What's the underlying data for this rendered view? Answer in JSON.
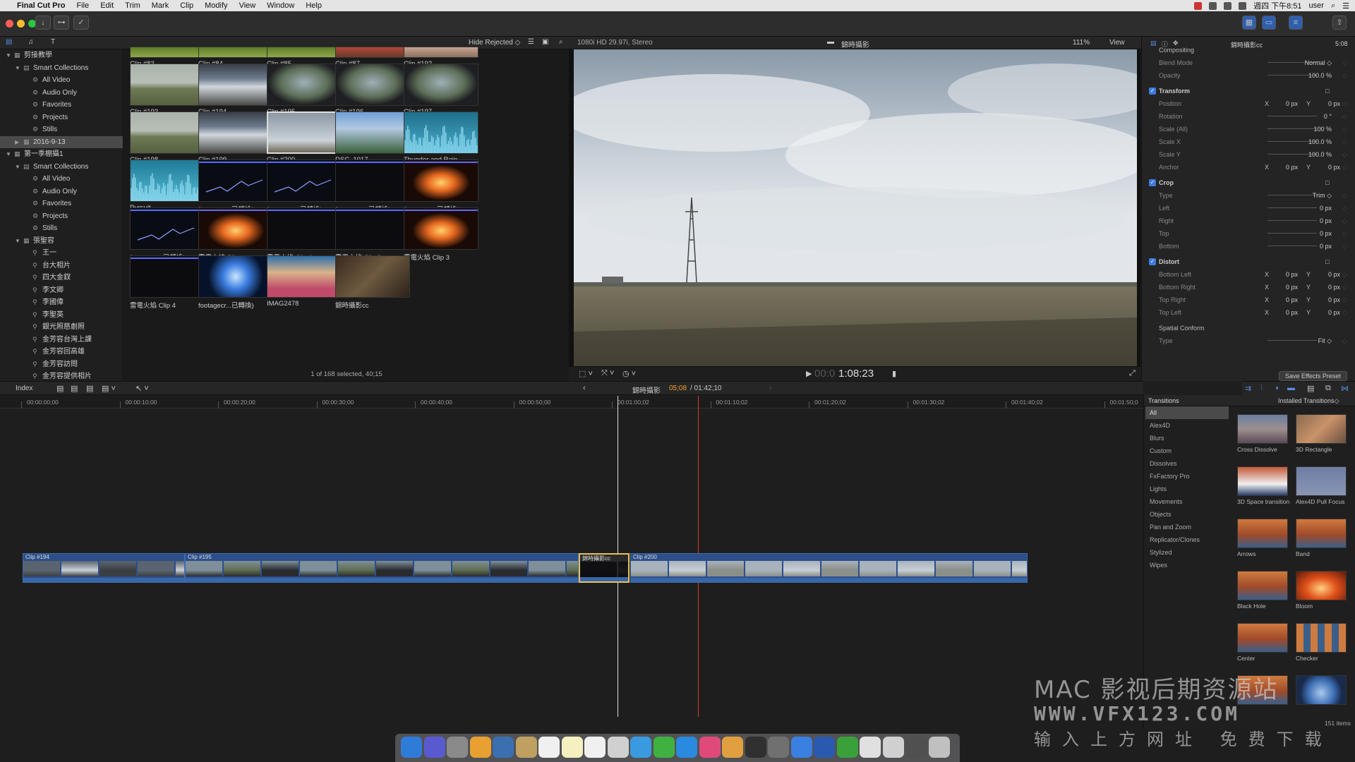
{
  "menubar": {
    "apple": "",
    "app": "Final Cut Pro",
    "items": [
      "File",
      "Edit",
      "Trim",
      "Mark",
      "Clip",
      "Modify",
      "View",
      "Window",
      "Help"
    ],
    "clock": "週四 下午8:51",
    "user": "user"
  },
  "browser_toolbar": {
    "filter": "Hide Rejected ◇",
    "format": "1080i HD 29.97i, Stereo",
    "viewer_title": "錦時攝影",
    "zoom": "111%",
    "view_menu": "View"
  },
  "library": {
    "items": [
      {
        "label": "剪接教學",
        "level": 0,
        "tri": "▼",
        "icon": "library"
      },
      {
        "label": "Smart Collections",
        "level": 1,
        "tri": "▼",
        "icon": "folder"
      },
      {
        "label": "All Video",
        "level": 2,
        "tri": "",
        "icon": "smart"
      },
      {
        "label": "Audio Only",
        "level": 2,
        "tri": "",
        "icon": "smart"
      },
      {
        "label": "Favorites",
        "level": 2,
        "tri": "",
        "icon": "smart"
      },
      {
        "label": "Projects",
        "level": 2,
        "tri": "",
        "icon": "smart"
      },
      {
        "label": "Stills",
        "level": 2,
        "tri": "",
        "icon": "smart"
      },
      {
        "label": "2016-9-13",
        "level": 1,
        "tri": "▶",
        "icon": "event",
        "selected": true
      },
      {
        "label": "第一季棚攝1",
        "level": 0,
        "tri": "▼",
        "icon": "library"
      },
      {
        "label": "Smart Collections",
        "level": 1,
        "tri": "▼",
        "icon": "folder"
      },
      {
        "label": "All Video",
        "level": 2,
        "tri": "",
        "icon": "smart"
      },
      {
        "label": "Audio Only",
        "level": 2,
        "tri": "",
        "icon": "smart"
      },
      {
        "label": "Favorites",
        "level": 2,
        "tri": "",
        "icon": "smart"
      },
      {
        "label": "Projects",
        "level": 2,
        "tri": "",
        "icon": "smart"
      },
      {
        "label": "Stills",
        "level": 2,
        "tri": "",
        "icon": "smart"
      },
      {
        "label": "張聖容",
        "level": 1,
        "tri": "▼",
        "icon": "event"
      },
      {
        "label": "王一",
        "level": 2,
        "tri": "",
        "icon": "keyword"
      },
      {
        "label": "台大相片",
        "level": 2,
        "tri": "",
        "icon": "keyword"
      },
      {
        "label": "四大金釵",
        "level": 2,
        "tri": "",
        "icon": "keyword"
      },
      {
        "label": "李文卿",
        "level": 2,
        "tri": "",
        "icon": "keyword"
      },
      {
        "label": "李國偉",
        "level": 2,
        "tri": "",
        "icon": "keyword"
      },
      {
        "label": "李聖英",
        "level": 2,
        "tri": "",
        "icon": "keyword"
      },
      {
        "label": "銀光照慈劇照",
        "level": 2,
        "tri": "",
        "icon": "keyword"
      },
      {
        "label": "金芳容台灣上課",
        "level": 2,
        "tri": "",
        "icon": "keyword"
      },
      {
        "label": "金芳容回高雄",
        "level": 2,
        "tri": "",
        "icon": "keyword"
      },
      {
        "label": "金芳容訪問",
        "level": 2,
        "tri": "",
        "icon": "keyword"
      },
      {
        "label": "金芳容提供相片",
        "level": 2,
        "tri": "",
        "icon": "keyword"
      }
    ]
  },
  "browser": {
    "clips": [
      {
        "label": "Clip #83",
        "thumb": "green"
      },
      {
        "label": "Clip #84",
        "thumb": "green"
      },
      {
        "label": "Clip #85",
        "thumb": "green"
      },
      {
        "label": "Clip #87",
        "thumb": "red"
      },
      {
        "label": "Clip #192",
        "thumb": "pale"
      },
      {
        "label": "Clip #193",
        "thumb": "field"
      },
      {
        "label": "Clip #194",
        "thumb": "train"
      },
      {
        "label": "Clip #195",
        "thumb": "window"
      },
      {
        "label": "Clip #196",
        "thumb": "window"
      },
      {
        "label": "Clip #197",
        "thumb": "window"
      },
      {
        "label": "Clip #198",
        "thumb": "field"
      },
      {
        "label": "Clip #199",
        "thumb": "train"
      },
      {
        "label": "Clip #200",
        "thumb": "sky",
        "selected": true
      },
      {
        "label": "DSC_1017",
        "thumb": "building"
      },
      {
        "label": "Thunder and Rain",
        "thumb": "audio"
      },
      {
        "label": "Pursuit",
        "thumb": "audio2"
      },
      {
        "label": "footagecr...已轉換)",
        "thumb": "lightning"
      },
      {
        "label": "footagecr...已轉換)",
        "thumb": "lightning"
      },
      {
        "label": "footagecr...已轉換)",
        "thumb": "dark"
      },
      {
        "label": "footagecr...已轉換)",
        "thumb": "fire"
      },
      {
        "label": "footagecr...已轉換)",
        "thumb": "lightning"
      },
      {
        "label": "雷電火焰 Clip",
        "thumb": "fire"
      },
      {
        "label": "雷電火焰 Clip 1",
        "thumb": "dark"
      },
      {
        "label": "雷電火焰 Clip 2",
        "thumb": "dark"
      },
      {
        "label": "雷電火焰 Clip 3",
        "thumb": "fire"
      },
      {
        "label": "雷電火焰 Clip 4",
        "thumb": "dark"
      },
      {
        "label": "footagecr...已轉換)",
        "thumb": "energy"
      },
      {
        "label": "IMAG2478",
        "thumb": "person"
      },
      {
        "label": "錦時攝影cc",
        "thumb": "title"
      }
    ],
    "status": "1 of 168 selected, 40;15"
  },
  "viewer": {
    "timecode": "1:08:23",
    "timecode_dim": "00:0"
  },
  "inspector": {
    "title": "錦時攝影cc",
    "duration": "5:08",
    "rows": [
      {
        "label": "Compositing",
        "type": "section"
      },
      {
        "label": "Blend Mode",
        "value": "Normal ◇"
      },
      {
        "label": "Opacity",
        "value": "100.0 %"
      },
      {
        "label": "Transform",
        "type": "check"
      },
      {
        "label": "Position",
        "x": "0 px",
        "y": "0 px"
      },
      {
        "label": "Rotation",
        "value": "0 °"
      },
      {
        "label": "Scale (All)",
        "value": "100 %"
      },
      {
        "label": "Scale X",
        "value": "100.0 %"
      },
      {
        "label": "Scale Y",
        "value": "100.0 %"
      },
      {
        "label": "Anchor",
        "x": "0 px",
        "y": "0 px"
      },
      {
        "label": "Crop",
        "type": "check"
      },
      {
        "label": "Type",
        "value": "Trim ◇"
      },
      {
        "label": "Left",
        "value": "0 px"
      },
      {
        "label": "Right",
        "value": "0 px"
      },
      {
        "label": "Top",
        "value": "0 px"
      },
      {
        "label": "Bottom",
        "value": "0 px"
      },
      {
        "label": "Distort",
        "type": "check"
      },
      {
        "label": "Bottom Left",
        "x": "0 px",
        "y": "0 px"
      },
      {
        "label": "Bottom Right",
        "x": "0 px",
        "y": "0 px"
      },
      {
        "label": "Top Right",
        "x": "0 px",
        "y": "0 px"
      },
      {
        "label": "Top Left",
        "x": "0 px",
        "y": "0 px"
      },
      {
        "label": "Spatial Conform",
        "type": "section"
      },
      {
        "label": "Type",
        "value": "Fit ◇"
      }
    ],
    "save_preset": "Save Effects Preset"
  },
  "timeline": {
    "index_label": "Index",
    "project": "錦時攝影",
    "position": "05;08",
    "total": "/ 01:42;10",
    "ruler": [
      "00:00:00;00",
      "00:00:10;00",
      "00:00:20;00",
      "00:00:30;00",
      "00:00:40;00",
      "00:00:50;00",
      "00:01:00;02",
      "00:01:10;02",
      "00:01:20;02",
      "00:01:30;02",
      "00:01:40;02",
      "00:01:50;0"
    ],
    "clips": [
      {
        "label": "Clip #194",
        "color": "train"
      },
      {
        "label": "Clip #195",
        "color": "window"
      },
      {
        "label": "錦時攝影cc",
        "color": "title"
      },
      {
        "label": "Clip #200",
        "color": "sky"
      }
    ]
  },
  "transitions": {
    "title": "Transitions",
    "installed": "Installed Transitions◇",
    "categories": [
      "All",
      "Alex4D",
      "Blurs",
      "Custom",
      "Dissolves",
      "FxFactory Pro",
      "Lights",
      "Movements",
      "Objects",
      "Pan and Zoom",
      "Replicator/Clones",
      "Stylized",
      "Wipes"
    ],
    "items": [
      {
        "label": "Cross Dissolve",
        "thumb": "mtn"
      },
      {
        "label": "3D Rectangle",
        "thumb": "mtn2"
      },
      {
        "label": "3D Space transition",
        "thumb": "space"
      },
      {
        "label": "Alex4D Pull Focus",
        "thumb": "blur"
      },
      {
        "label": "Arrows",
        "thumb": "arch"
      },
      {
        "label": "Band",
        "thumb": "arch"
      },
      {
        "label": "Black Hole",
        "thumb": "arch"
      },
      {
        "label": "Bloom",
        "thumb": "fire"
      },
      {
        "label": "Center",
        "thumb": "arch"
      },
      {
        "label": "Checker",
        "thumb": "check"
      },
      {
        "label": "",
        "thumb": "arch"
      },
      {
        "label": "",
        "thumb": "sphere"
      }
    ],
    "count": "151 items"
  },
  "watermark": {
    "line1": "MAC 影视后期资源站",
    "line2": "WWW.VFX123.COM",
    "line3": "输入上方网址 免费下载"
  },
  "colors": {
    "accent": "#3d7be0",
    "playhead": "#d83a2f",
    "clip_blue": "#2c4f8a",
    "timecode_orange": "#f0a030"
  }
}
